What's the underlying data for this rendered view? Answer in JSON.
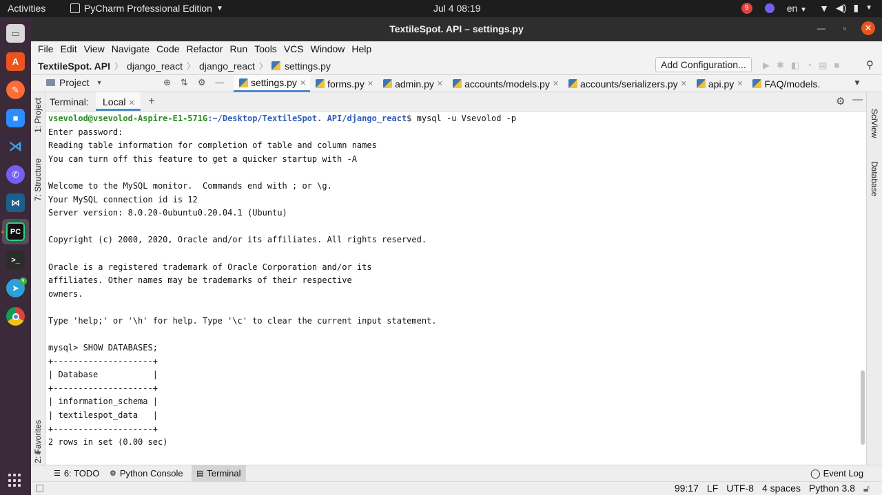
{
  "topbar": {
    "activities": "Activities",
    "app_name": "PyCharm Professional Edition",
    "clock": "Jul 4  08:19",
    "notification_count": "9",
    "language": "en"
  },
  "dock": {
    "telegram_badge": "9"
  },
  "window": {
    "title": "TextileSpot. API – settings.py"
  },
  "menu": [
    "File",
    "Edit",
    "View",
    "Navigate",
    "Code",
    "Refactor",
    "Run",
    "Tools",
    "VCS",
    "Window",
    "Help"
  ],
  "breadcrumbs": [
    "TextileSpot. API",
    "django_react",
    "django_react",
    "settings.py"
  ],
  "toolbar": {
    "add_configuration": "Add Configuration..."
  },
  "project_panel": {
    "label": "Project"
  },
  "editor_tabs": [
    "settings.py",
    "forms.py",
    "admin.py",
    "accounts/models.py",
    "accounts/serializers.py",
    "api.py",
    "FAQ/models."
  ],
  "left_strip": {
    "project": "1: Project",
    "structure": "7: Structure",
    "favorites": "2: Favorites"
  },
  "right_strip": {
    "sciview": "SciView",
    "database": "Database"
  },
  "terminal": {
    "label": "Terminal:",
    "tab": "Local",
    "prompt_user": "vsevolod@vsevolod-Aspire-E1-571G",
    "prompt_path": ":~/Desktop/TextileSpot. API/django_react",
    "prompt_command": "$ mysql -u Vsevolod -p",
    "lines": [
      "Enter password:",
      "Reading table information for completion of table and column names",
      "You can turn off this feature to get a quicker startup with -A",
      "",
      "Welcome to the MySQL monitor.  Commands end with ; or \\g.",
      "Your MySQL connection id is 12",
      "Server version: 8.0.20-0ubuntu0.20.04.1 (Ubuntu)",
      "",
      "Copyright (c) 2000, 2020, Oracle and/or its affiliates. All rights reserved.",
      "",
      "Oracle is a registered trademark of Oracle Corporation and/or its",
      "affiliates. Other names may be trademarks of their respective",
      "owners.",
      "",
      "Type 'help;' or '\\h' for help. Type '\\c' to clear the current input statement.",
      "",
      "mysql> SHOW DATABASES;",
      "+--------------------+",
      "| Database           |",
      "+--------------------+",
      "| information_schema |",
      "| textilespot_data   |",
      "+--------------------+",
      "2 rows in set (0.00 sec)"
    ]
  },
  "bottom_tabs": {
    "todo": "6: TODO",
    "python_console": "Python Console",
    "terminal": "Terminal",
    "event_log": "Event Log"
  },
  "status": {
    "position": "99:17",
    "line_sep": "LF",
    "encoding": "UTF-8",
    "indent": "4 spaces",
    "interpreter": "Python 3.8"
  }
}
